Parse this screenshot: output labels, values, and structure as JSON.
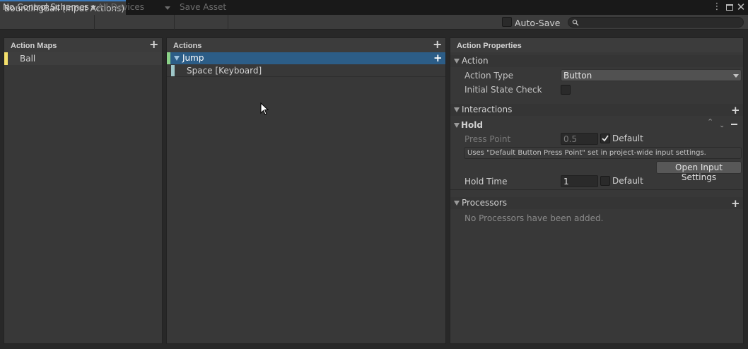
{
  "window": {
    "title": "BouncingBall (Input Actions)",
    "menu_icon": "kebab-menu-icon",
    "maximize_icon": "maximize-icon",
    "close_icon": "close-icon"
  },
  "toolbar": {
    "control_schemes": "No Control Schemes",
    "devices": "All Devices",
    "save_asset": "Save Asset",
    "auto_save_label": "Auto-Save",
    "auto_save_checked": false,
    "search_icon": "search-icon",
    "search_value": ""
  },
  "action_maps": {
    "header": "Action Maps",
    "items": [
      {
        "label": "Ball",
        "color": "#f4e06c"
      }
    ]
  },
  "actions": {
    "header": "Actions",
    "items": [
      {
        "label": "Jump",
        "color": "#8bd288",
        "selected": true
      },
      {
        "label": "Space [Keyboard]",
        "color": "#9ec7c9"
      }
    ]
  },
  "properties": {
    "header": "Action Properties",
    "action_section": "Action",
    "action_type_label": "Action Type",
    "action_type_value": "Button",
    "initial_state_label": "Initial State Check",
    "interactions_section": "Interactions",
    "hold_section": "Hold",
    "press_point_label": "Press Point",
    "press_point_value": "0.5",
    "press_point_default_label": "Default",
    "press_point_default_checked": true,
    "info_text": "Uses \"Default Button Press Point\" set in project-wide input settings.",
    "open_settings_button": "Open Input Settings",
    "hold_time_label": "Hold Time",
    "hold_time_value": "1",
    "hold_time_default_label": "Default",
    "hold_time_default_checked": false,
    "processors_section": "Processors",
    "no_processors_text": "No Processors have been added."
  },
  "colors": {
    "accent_blue": "#3a79bb",
    "selection_blue": "#2c5d87"
  }
}
